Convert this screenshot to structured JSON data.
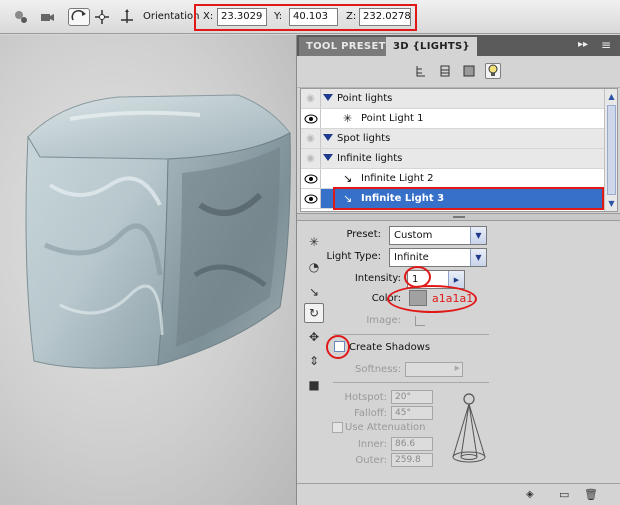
{
  "toolbar": {
    "orientation_label": "Orientation",
    "x_label": "X:",
    "x_value": "23.3029",
    "y_label": "Y:",
    "y_value": "40.103",
    "z_label": "Z:",
    "z_value": "232.0278"
  },
  "panel": {
    "tabs": [
      "TOOL PRESETS",
      "3D {LIGHTS}"
    ],
    "tab_menu_icon": "≡",
    "collapse_icon": "▸▸",
    "tree": {
      "groups": [
        {
          "label": "Point lights",
          "items": [
            "Point Light 1"
          ]
        },
        {
          "label": "Spot lights",
          "items": []
        },
        {
          "label": "Infinite lights",
          "items": [
            "Infinite Light 2",
            "Infinite Light 3"
          ]
        }
      ],
      "selected": "Infinite Light 3"
    },
    "properties": {
      "preset_label": "Preset:",
      "preset_value": "Custom",
      "light_type_label": "Light Type:",
      "light_type_value": "Infinite",
      "intensity_label": "Intensity:",
      "intensity_value": "1",
      "color_label": "Color:",
      "color_value": "#a1a1a1",
      "color_annotation": "a1a1a1",
      "image_label": "Image:",
      "create_shadows_label": "Create Shadows",
      "softness_label": "Softness:",
      "hotspot_label": "Hotspot:",
      "hotspot_value": "20°",
      "falloff_label": "Falloff:",
      "falloff_value": "45°",
      "use_attenuation_label": "Use Attenuation",
      "inner_label": "Inner:",
      "inner_value": "86.6",
      "outer_label": "Outer:",
      "outer_value": "259.8"
    }
  },
  "colors": {
    "annotation_red": "#e01818",
    "selection_blue": "#3670c9",
    "tree_triangle": "#1f3a8a"
  }
}
